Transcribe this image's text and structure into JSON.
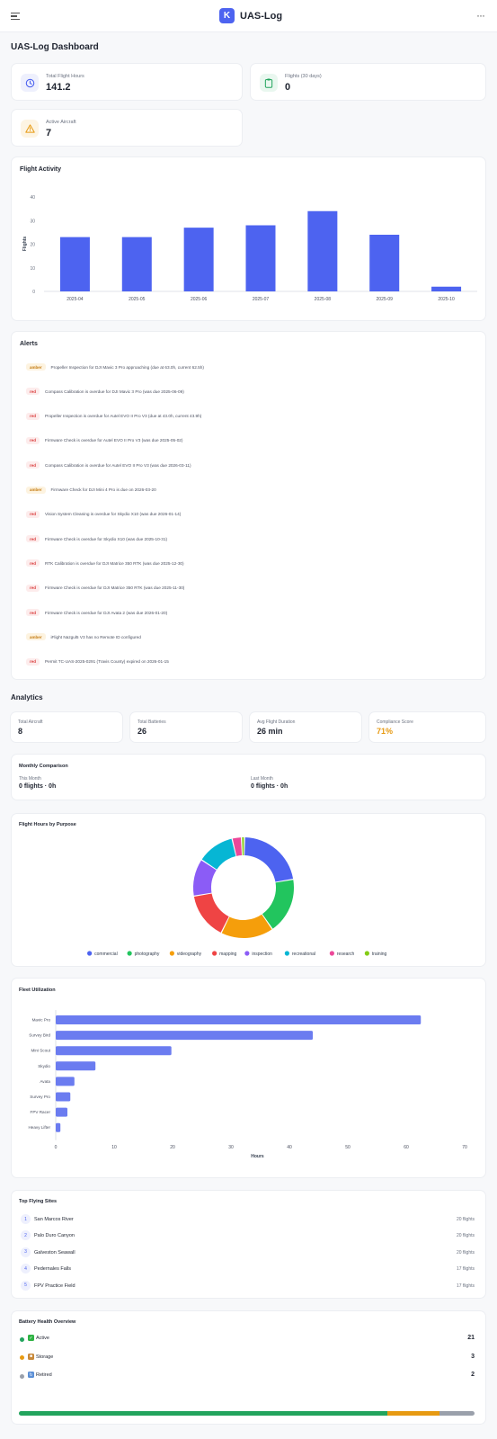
{
  "header": {
    "logo_letter": "K",
    "app_name": "UAS-Log",
    "menu_icon": "hamburger-menu-icon",
    "more_icon": "more-horizontal-icon",
    "more_glyph": "···"
  },
  "dashboard": {
    "title": "UAS-Log Dashboard",
    "stats": [
      {
        "label": "Total Flight Hours",
        "value": "141.2",
        "icon": "clock-icon",
        "color": "#4d63f0"
      },
      {
        "label": "Flights (30 days)",
        "value": "0",
        "icon": "clipboard-icon",
        "color": "#22a45d"
      },
      {
        "label": "Active Aircraft",
        "value": "7",
        "icon": "warning-icon",
        "color": "#e79a12"
      }
    ]
  },
  "flight_activity": {
    "title": "Flight Activity",
    "chart_data": {
      "type": "bar",
      "categories": [
        "2025-04",
        "2025-05",
        "2025-06",
        "2025-07",
        "2025-08",
        "2025-09",
        "2025-10"
      ],
      "values": [
        23,
        23,
        27,
        28,
        34,
        24,
        2
      ],
      "ylabel": "Flights",
      "ylim": [
        0,
        40
      ],
      "yticks": [
        "0",
        "10",
        "20",
        "30",
        "40"
      ],
      "color": "#4d63f0",
      "grid": false
    }
  },
  "alerts": {
    "title": "Alerts",
    "items": [
      {
        "level": "amber",
        "text": "Propeller Inspection for DJI Mavic 3 Pro approaching (due at 63.0h, current 62.5h)"
      },
      {
        "level": "red",
        "text": "Compass Calibration is overdue for DJI Mavic 3 Pro (was due 2025-06-09)"
      },
      {
        "level": "red",
        "text": "Propeller Inspection is overdue for Autel EVO II Pro V3 (due at 43.0h, current 43.9h)"
      },
      {
        "level": "red",
        "text": "Firmware Check is overdue for Autel EVO II Pro V3 (was due 2025-05-02)"
      },
      {
        "level": "red",
        "text": "Compass Calibration is overdue for Autel EVO II Pro V3 (was due 2026-03-11)"
      },
      {
        "level": "amber",
        "text": "Firmware Check for DJI Mini 4 Pro is due on 2026-03-20"
      },
      {
        "level": "red",
        "text": "Vision System Cleaning is overdue for Skydio X10 (was due 2026-01-14)"
      },
      {
        "level": "red",
        "text": "Firmware Check is overdue for Skydio X10 (was due 2025-10-31)"
      },
      {
        "level": "red",
        "text": "RTK Calibration is overdue for DJI Matrice 350 RTK (was due 2025-12-30)"
      },
      {
        "level": "red",
        "text": "Firmware Check is overdue for DJI Matrice 350 RTK (was due 2025-11-30)"
      },
      {
        "level": "red",
        "text": "Firmware Check is overdue for DJI Avata 2 (was due 2026-01-20)"
      },
      {
        "level": "amber",
        "text": "iFlight Nazgul5 V3 has no Remote ID configured"
      },
      {
        "level": "red",
        "text": "Permit TC-UAS-2025-0291 (Travis County) expired on 2026-01-15"
      }
    ]
  },
  "analytics": {
    "title": "Analytics",
    "cards": [
      {
        "label": "Total Aircraft",
        "value": "8",
        "color": "#1f2430"
      },
      {
        "label": "Total Batteries",
        "value": "26",
        "color": "#1f2430"
      },
      {
        "label": "Avg Flight Duration",
        "value": "26 min",
        "color": "#1f2430"
      },
      {
        "label": "Compliance Score",
        "value": "71%",
        "color": "#e79a12"
      }
    ],
    "monthly": {
      "title": "Monthly Comparison",
      "this_label": "This Month",
      "this_value": "0 flights · 0h",
      "last_label": "Last Month",
      "last_value": "0 flights · 0h"
    }
  },
  "purpose_chart": {
    "title": "Flight Hours by Purpose",
    "chart_data": {
      "type": "pie",
      "categories": [
        "commercial",
        "photography",
        "videography",
        "mapping",
        "inspection",
        "recreational",
        "research",
        "training"
      ],
      "values": [
        22,
        18,
        17,
        15,
        12,
        12,
        3,
        1
      ],
      "colors": [
        "#4d63f0",
        "#22c55e",
        "#f59e0b",
        "#ef4444",
        "#8b5cf6",
        "#06b6d4",
        "#ec4899",
        "#84cc16"
      ],
      "legend": "bottom"
    }
  },
  "fleet": {
    "title": "Fleet Utilization",
    "chart_data": {
      "type": "bar",
      "orientation": "horizontal",
      "categories": [
        "Mavic Pro",
        "Survey Bird",
        "Mini Scout",
        "Skydio",
        "Avata",
        "Survey Pro",
        "FPV Racer",
        "Heavy Lifter"
      ],
      "values": [
        62.5,
        44,
        19.8,
        6.8,
        3.2,
        2.5,
        2,
        0.8
      ],
      "xlabel": "Hours",
      "xlim": [
        0,
        70
      ],
      "xticks": [
        "0",
        "10",
        "20",
        "30",
        "40",
        "50",
        "60",
        "70"
      ],
      "color": "#6b7cf0"
    }
  },
  "sites": {
    "title": "Top Flying Sites",
    "items": [
      {
        "rank": "1",
        "name": "San Marcos River",
        "count": "20 flights"
      },
      {
        "rank": "2",
        "name": "Palo Duro Canyon",
        "count": "20 flights"
      },
      {
        "rank": "3",
        "name": "Galveston Seawall",
        "count": "20 flights"
      },
      {
        "rank": "4",
        "name": "Pedernales Falls",
        "count": "17 flights"
      },
      {
        "rank": "5",
        "name": "FPV Practice Field",
        "count": "17 flights"
      }
    ]
  },
  "battery": {
    "title": "Battery Health Overview",
    "items": [
      {
        "label": "Active",
        "count": "21",
        "value": 21,
        "color": "#22a45d",
        "icon": "check-box-icon",
        "glyph": "✓",
        "icon_color": "#2fb344"
      },
      {
        "label": "Storage",
        "count": "3",
        "value": 3,
        "color": "#e79a12",
        "icon": "package-icon",
        "glyph": "■",
        "icon_color": "#c8893a"
      },
      {
        "label": "Retired",
        "count": "2",
        "value": 2,
        "color": "#9aa0ab",
        "icon": "recycle-icon",
        "glyph": "↻",
        "icon_color": "#5b8fd6"
      }
    ]
  }
}
